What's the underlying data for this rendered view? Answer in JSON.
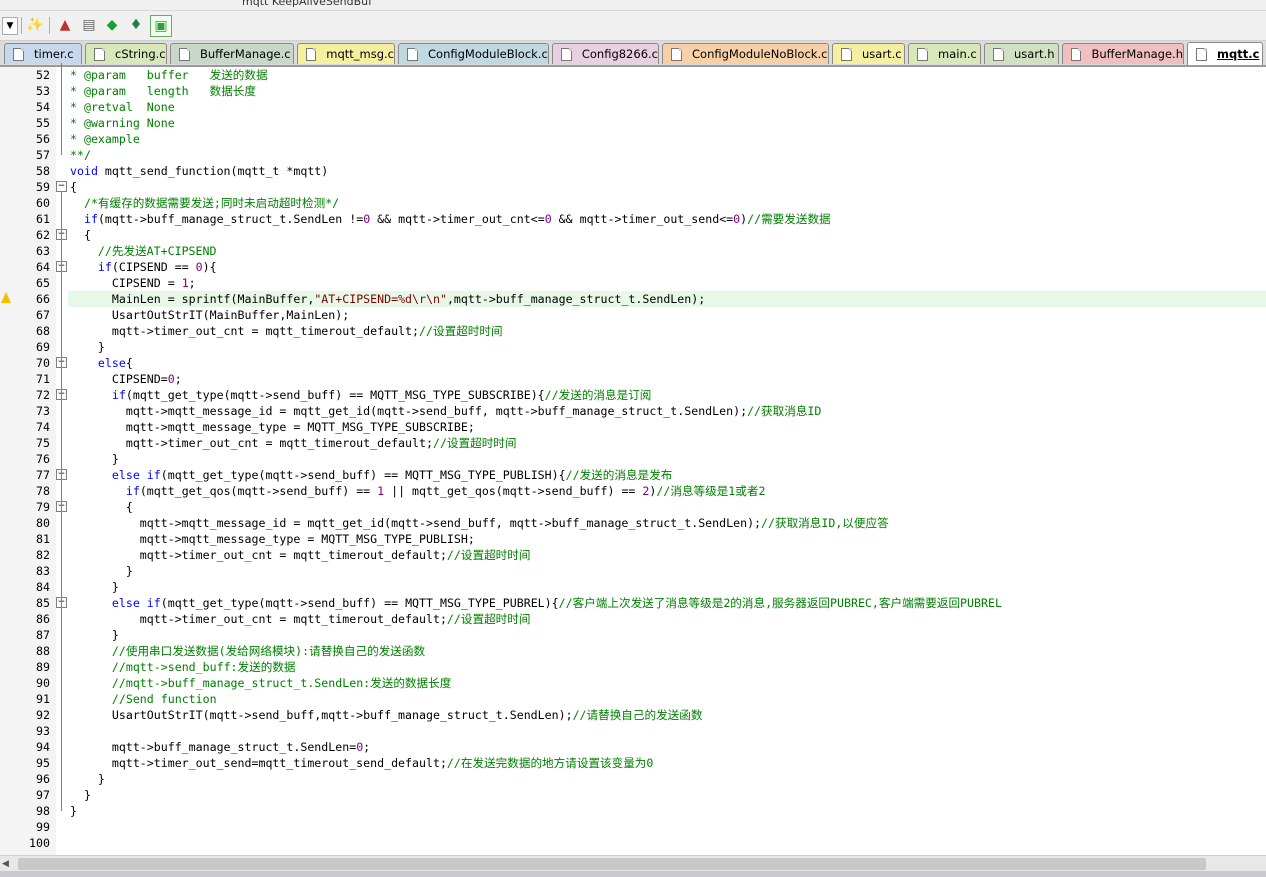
{
  "toolbar_top": {
    "fragment": "mqtt   KeepAliveSendBuf"
  },
  "tabs": [
    {
      "label": "timer.c",
      "color": "#c8d8ec"
    },
    {
      "label": "cString.c",
      "color": "#d8e8b8"
    },
    {
      "label": "BufferManage.c",
      "color": "#c8d8c8"
    },
    {
      "label": "mqtt_msg.c",
      "color": "#f4f0a0"
    },
    {
      "label": "ConfigModuleBlock.c",
      "color": "#c0d8e0"
    },
    {
      "label": "Config8266.c",
      "color": "#e8d0e0"
    },
    {
      "label": "ConfigModuleNoBlock.c",
      "color": "#f8d0a8"
    },
    {
      "label": "usart.c",
      "color": "#f4f0a0"
    },
    {
      "label": "main.c",
      "color": "#d8e8b8"
    },
    {
      "label": "usart.h",
      "color": "#d0e0c0"
    },
    {
      "label": "BufferManage.h",
      "color": "#f0c0c0"
    },
    {
      "label": "mqtt.c",
      "color": "#ffffff"
    }
  ],
  "editor": {
    "lines": [
      {
        "n": "52",
        "t": "* @param   buffer   发送的数据"
      },
      {
        "n": "53",
        "t": "* @param   length   数据长度"
      },
      {
        "n": "54",
        "t": "* @retval  None"
      },
      {
        "n": "55",
        "t": "* @warning None"
      },
      {
        "n": "56",
        "t": "* @example"
      },
      {
        "n": "57",
        "t": "**/"
      },
      {
        "n": "58",
        "t": "void mqtt_send_function(mqtt_t *mqtt)"
      },
      {
        "n": "59",
        "t": "{"
      },
      {
        "n": "60",
        "t": "  /*有缓存的数据需要发送;同时未启动超时检测*/"
      },
      {
        "n": "61",
        "t": "  if(mqtt->buff_manage_struct_t.SendLen !=0 && mqtt->timer_out_cnt<=0 && mqtt->timer_out_send<=0)//需要发送数据"
      },
      {
        "n": "62",
        "t": "  {"
      },
      {
        "n": "63",
        "t": "    //先发送AT+CIPSEND"
      },
      {
        "n": "64",
        "t": "    if(CIPSEND == 0){"
      },
      {
        "n": "65",
        "t": "      CIPSEND = 1;"
      },
      {
        "n": "66",
        "t": "      MainLen = sprintf(MainBuffer,\"AT+CIPSEND=%d\\r\\n\",mqtt->buff_manage_struct_t.SendLen);"
      },
      {
        "n": "67",
        "t": "      UsartOutStrIT(MainBuffer,MainLen);"
      },
      {
        "n": "68",
        "t": "      mqtt->timer_out_cnt = mqtt_timerout_default;//设置超时时间"
      },
      {
        "n": "69",
        "t": "    }"
      },
      {
        "n": "70",
        "t": "    else{"
      },
      {
        "n": "71",
        "t": "      CIPSEND=0;"
      },
      {
        "n": "72",
        "t": "      if(mqtt_get_type(mqtt->send_buff) == MQTT_MSG_TYPE_SUBSCRIBE){//发送的消息是订阅"
      },
      {
        "n": "73",
        "t": "        mqtt->mqtt_message_id = mqtt_get_id(mqtt->send_buff, mqtt->buff_manage_struct_t.SendLen);//获取消息ID"
      },
      {
        "n": "74",
        "t": "        mqtt->mqtt_message_type = MQTT_MSG_TYPE_SUBSCRIBE;"
      },
      {
        "n": "75",
        "t": "        mqtt->timer_out_cnt = mqtt_timerout_default;//设置超时时间"
      },
      {
        "n": "76",
        "t": "      }"
      },
      {
        "n": "77",
        "t": "      else if(mqtt_get_type(mqtt->send_buff) == MQTT_MSG_TYPE_PUBLISH){//发送的消息是发布"
      },
      {
        "n": "78",
        "t": "        if(mqtt_get_qos(mqtt->send_buff) == 1 || mqtt_get_qos(mqtt->send_buff) == 2)//消息等级是1或者2"
      },
      {
        "n": "79",
        "t": "        {"
      },
      {
        "n": "80",
        "t": "          mqtt->mqtt_message_id = mqtt_get_id(mqtt->send_buff, mqtt->buff_manage_struct_t.SendLen);//获取消息ID,以便应答"
      },
      {
        "n": "81",
        "t": "          mqtt->mqtt_message_type = MQTT_MSG_TYPE_PUBLISH;"
      },
      {
        "n": "82",
        "t": "          mqtt->timer_out_cnt = mqtt_timerout_default;//设置超时时间"
      },
      {
        "n": "83",
        "t": "        }"
      },
      {
        "n": "84",
        "t": "      }"
      },
      {
        "n": "85",
        "t": "      else if(mqtt_get_type(mqtt->send_buff) == MQTT_MSG_TYPE_PUBREL){//客户端上次发送了消息等级是2的消息,服务器返回PUBREC,客户端需要返回PUBREL"
      },
      {
        "n": "86",
        "t": "          mqtt->timer_out_cnt = mqtt_timerout_default;//设置超时时间"
      },
      {
        "n": "87",
        "t": "      }"
      },
      {
        "n": "88",
        "t": "      //使用串口发送数据(发给网络模块):请替换自己的发送函数"
      },
      {
        "n": "89",
        "t": "      //mqtt->send_buff:发送的数据"
      },
      {
        "n": "90",
        "t": "      //mqtt->buff_manage_struct_t.SendLen:发送的数据长度"
      },
      {
        "n": "91",
        "t": "      //Send function"
      },
      {
        "n": "92",
        "t": "      UsartOutStrIT(mqtt->send_buff,mqtt->buff_manage_struct_t.SendLen);//请替换自己的发送函数"
      },
      {
        "n": "93",
        "t": ""
      },
      {
        "n": "94",
        "t": "      mqtt->buff_manage_struct_t.SendLen=0;"
      },
      {
        "n": "95",
        "t": "      mqtt->timer_out_send=mqtt_timerout_send_default;//在发送完数据的地方请设置该变量为0"
      },
      {
        "n": "96",
        "t": "    }"
      },
      {
        "n": "97",
        "t": "  }"
      },
      {
        "n": "98",
        "t": "}"
      },
      {
        "n": "99",
        "t": ""
      },
      {
        "n": "100",
        "t": ""
      }
    ]
  },
  "colors": {
    "comment": "#008000",
    "keyword": "#0000ff",
    "number": "#800080",
    "string": "#800000",
    "annotation_arrow": "#e8403a",
    "current_line": "#e8f8e8"
  }
}
